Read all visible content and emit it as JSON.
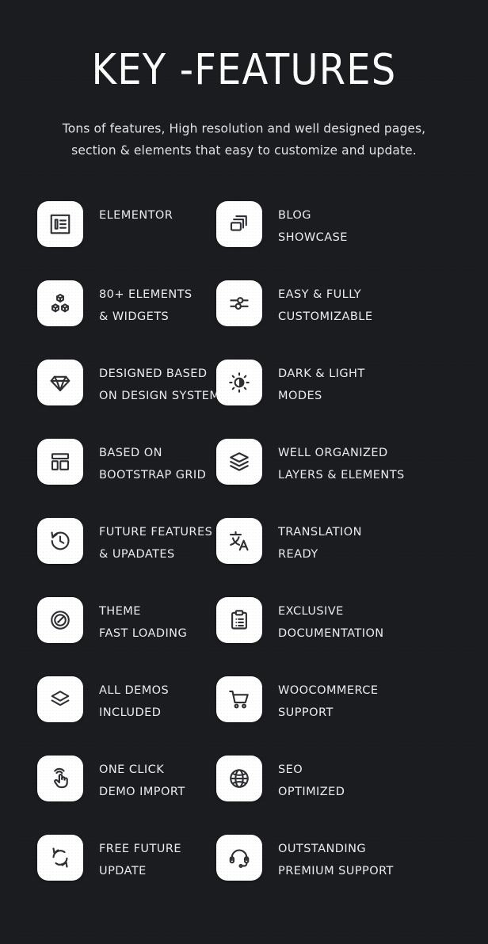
{
  "header": {
    "title": "KEY -FEATURES",
    "subtitle_line1": "Tons of  features, High resolution and well designed pages,",
    "subtitle_line2": "section & elements that easy to customize and update."
  },
  "theme": {
    "background": "#1a1c20",
    "icon_tile": "#ffffff",
    "icon_stroke": "#2d2f33",
    "text": "#eceded",
    "title_text": "#fdfdfd"
  },
  "features": [
    {
      "icon": "elementor-icon",
      "line1": "ELEMENTOR",
      "line2": ""
    },
    {
      "icon": "blog-windows-icon",
      "line1": "BLOG",
      "line2": "SHOWCASE"
    },
    {
      "icon": "elements-blocks-icon",
      "line1": "80+ ELEMENTS",
      "line2": "& WIDGETS"
    },
    {
      "icon": "sliders-settings-icon",
      "line1": "EASY & FULLY",
      "line2": "CUSTOMIZABLE"
    },
    {
      "icon": "diamond-sketch-icon",
      "line1": "DESIGNED BASED",
      "line2": "ON DESIGN SYSTEM"
    },
    {
      "icon": "brightness-sun-icon",
      "line1": "DARK & LIGHT",
      "line2": "MODES"
    },
    {
      "icon": "layout-grid-icon",
      "line1": "BASED ON",
      "line2": "BOOTSTRAP GRID"
    },
    {
      "icon": "layers-stack-icon",
      "line1": "WELL ORGANIZED",
      "line2": "LAYERS & ELEMENTS"
    },
    {
      "icon": "clock-history-icon",
      "line1": "FUTURE FEATURES",
      "line2": "& UPADATES"
    },
    {
      "icon": "translate-icon",
      "line1": "TRANSLATION",
      "line2": "READY"
    },
    {
      "icon": "speedometer-icon",
      "line1": "THEME",
      "line2": "FAST LOADING"
    },
    {
      "icon": "clipboard-list-icon",
      "line1": "EXCLUSIVE",
      "line2": "DOCUMENTATION"
    },
    {
      "icon": "layers-diamond-icon",
      "line1": "ALL DEMOS",
      "line2": "INCLUDED"
    },
    {
      "icon": "shopping-cart-icon",
      "line1": "WOOCOMMERCE",
      "line2": "SUPPORT"
    },
    {
      "icon": "tap-hand-icon",
      "line1": "ONE CLICK",
      "line2": "DEMO IMPORT"
    },
    {
      "icon": "globe-icon",
      "line1": "SEO",
      "line2": "OPTIMIZED"
    },
    {
      "icon": "refresh-sync-icon",
      "line1": "FREE FUTURE",
      "line2": "UPDATE"
    },
    {
      "icon": "headset-support-icon",
      "line1": "OUTSTANDING",
      "line2": "PREMIUM SUPPORT"
    }
  ]
}
